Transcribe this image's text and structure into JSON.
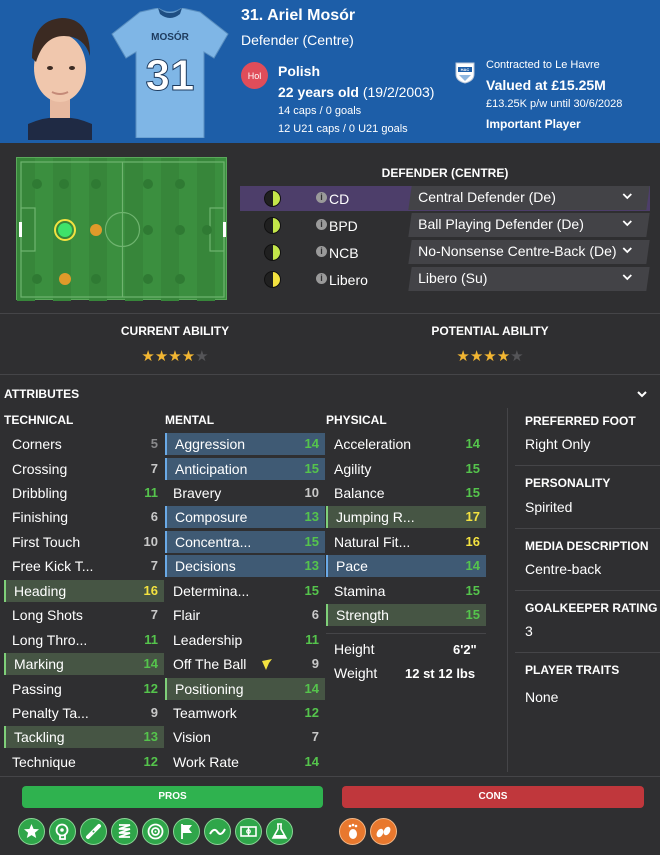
{
  "header": {
    "name": "31. Ariel Mosór",
    "position": "Defender (Centre)",
    "shirt_name": "MOSÓR",
    "shirt_number": "31",
    "nation_badge": "Hol",
    "nationality": "Polish",
    "age": "22 years old",
    "dob": "(19/2/2003)",
    "caps": "14 caps / 0 goals",
    "u21_caps": "12 U21 caps / 0 U21 goals",
    "contract": "Contracted to Le Havre",
    "value": "Valued at £15.25M",
    "wage": "£13.25K p/w until 30/6/2028",
    "status": "Important Player",
    "club_badge_text": "HAC"
  },
  "roles": {
    "title": "DEFENDER (CENTRE)",
    "items": [
      {
        "code": "CD",
        "role": "Central Defender (De)",
        "selected": true,
        "fill": "#c4e64a"
      },
      {
        "code": "BPD",
        "role": "Ball Playing Defender (De)",
        "selected": false,
        "fill": "#c4e64a"
      },
      {
        "code": "NCB",
        "role": "No-Nonsense Centre-Back (De)",
        "selected": false,
        "fill": "#c4e64a"
      },
      {
        "code": "Libero",
        "role": "Libero (Su)",
        "selected": false,
        "fill": "#f3e240"
      }
    ]
  },
  "ability": {
    "current_label": "CURRENT ABILITY",
    "current_stars": 4,
    "potential_label": "POTENTIAL ABILITY",
    "potential_stars": 4,
    "max_stars": 5
  },
  "attributes": {
    "title": "ATTRIBUTES",
    "technical": {
      "title": "TECHNICAL",
      "items": [
        {
          "name": "Corners",
          "value": "5"
        },
        {
          "name": "Crossing",
          "value": "7"
        },
        {
          "name": "Dribbling",
          "value": "11"
        },
        {
          "name": "Finishing",
          "value": "6"
        },
        {
          "name": "First Touch",
          "value": "10"
        },
        {
          "name": "Free Kick T...",
          "value": "7"
        },
        {
          "name": "Heading",
          "value": "16"
        },
        {
          "name": "Long Shots",
          "value": "7"
        },
        {
          "name": "Long Thro...",
          "value": "11"
        },
        {
          "name": "Marking",
          "value": "14"
        },
        {
          "name": "Passing",
          "value": "12"
        },
        {
          "name": "Penalty Ta...",
          "value": "9"
        },
        {
          "name": "Tackling",
          "value": "13"
        },
        {
          "name": "Technique",
          "value": "12"
        }
      ]
    },
    "mental": {
      "title": "MENTAL",
      "items": [
        {
          "name": "Aggression",
          "value": "14"
        },
        {
          "name": "Anticipation",
          "value": "15"
        },
        {
          "name": "Bravery",
          "value": "10"
        },
        {
          "name": "Composure",
          "value": "13"
        },
        {
          "name": "Concentra...",
          "value": "15"
        },
        {
          "name": "Decisions",
          "value": "13"
        },
        {
          "name": "Determina...",
          "value": "15"
        },
        {
          "name": "Flair",
          "value": "6"
        },
        {
          "name": "Leadership",
          "value": "11"
        },
        {
          "name": "Off The Ball",
          "value": "9"
        },
        {
          "name": "Positioning",
          "value": "14"
        },
        {
          "name": "Teamwork",
          "value": "12"
        },
        {
          "name": "Vision",
          "value": "7"
        },
        {
          "name": "Work Rate",
          "value": "14"
        }
      ]
    },
    "physical": {
      "title": "PHYSICAL",
      "items": [
        {
          "name": "Acceleration",
          "value": "14"
        },
        {
          "name": "Agility",
          "value": "15"
        },
        {
          "name": "Balance",
          "value": "15"
        },
        {
          "name": "Jumping R...",
          "value": "17"
        },
        {
          "name": "Natural Fit...",
          "value": "16"
        },
        {
          "name": "Pace",
          "value": "14"
        },
        {
          "name": "Stamina",
          "value": "15"
        },
        {
          "name": "Strength",
          "value": "15"
        }
      ],
      "height_label": "Height",
      "height": "6'2\"",
      "weight_label": "Weight",
      "weight": "12 st 12 lbs"
    }
  },
  "side": {
    "foot_label": "PREFERRED FOOT",
    "foot": "Right Only",
    "personality_label": "PERSONALITY",
    "personality": "Spirited",
    "media_label": "MEDIA DESCRIPTION",
    "media": "Centre-back",
    "gk_label": "GOALKEEPER RATING",
    "gk": "3",
    "traits_label": "PLAYER TRAITS",
    "traits": "None"
  },
  "pros_label": "PROS",
  "cons_label": "CONS",
  "pro_icons": [
    "star-icon",
    "brain-icon",
    "bandage-icon",
    "spring-icon",
    "target-icon",
    "flag-icon",
    "wave-icon",
    "pitch-icon",
    "flask-icon"
  ],
  "con_icons": [
    "foot-icon",
    "feet-icon"
  ],
  "colors": {
    "header_bg": "#1d5ea8",
    "pros": "#2fb24f",
    "cons": "#c0373c",
    "value_good": "#55c44c",
    "value_high": "#f3e240"
  }
}
